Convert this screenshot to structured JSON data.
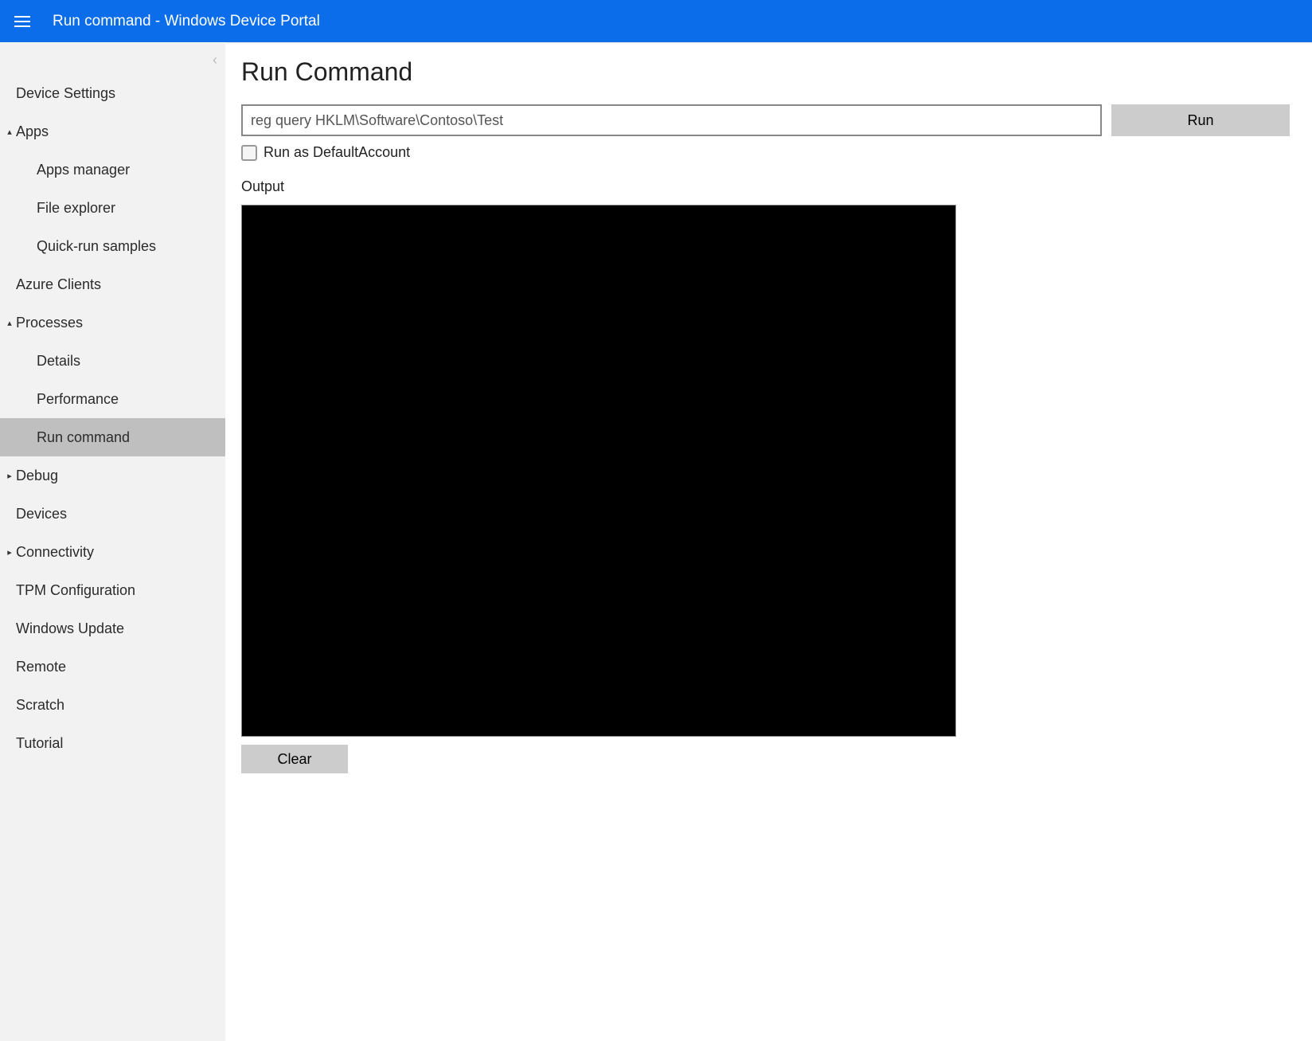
{
  "header": {
    "title": "Run command - Windows Device Portal"
  },
  "sidebar": {
    "items": [
      {
        "label": "Device Settings",
        "level": 0,
        "caret": ""
      },
      {
        "label": "Apps",
        "level": 0,
        "caret": "▴"
      },
      {
        "label": "Apps manager",
        "level": 1,
        "caret": ""
      },
      {
        "label": "File explorer",
        "level": 1,
        "caret": ""
      },
      {
        "label": "Quick-run samples",
        "level": 1,
        "caret": ""
      },
      {
        "label": "Azure Clients",
        "level": 0,
        "caret": ""
      },
      {
        "label": "Processes",
        "level": 0,
        "caret": "▴"
      },
      {
        "label": "Details",
        "level": 1,
        "caret": ""
      },
      {
        "label": "Performance",
        "level": 1,
        "caret": ""
      },
      {
        "label": "Run command",
        "level": 1,
        "caret": "",
        "active": true
      },
      {
        "label": "Debug",
        "level": 0,
        "caret": "▸"
      },
      {
        "label": "Devices",
        "level": 0,
        "caret": ""
      },
      {
        "label": "Connectivity",
        "level": 0,
        "caret": "▸"
      },
      {
        "label": "TPM Configuration",
        "level": 0,
        "caret": ""
      },
      {
        "label": "Windows Update",
        "level": 0,
        "caret": ""
      },
      {
        "label": "Remote",
        "level": 0,
        "caret": ""
      },
      {
        "label": "Scratch",
        "level": 0,
        "caret": ""
      },
      {
        "label": "Tutorial",
        "level": 0,
        "caret": ""
      }
    ]
  },
  "main": {
    "title": "Run Command",
    "command_value": "reg query HKLM\\Software\\Contoso\\Test",
    "run_label": "Run",
    "checkbox_label": "Run as DefaultAccount",
    "output_label": "Output",
    "clear_label": "Clear"
  }
}
